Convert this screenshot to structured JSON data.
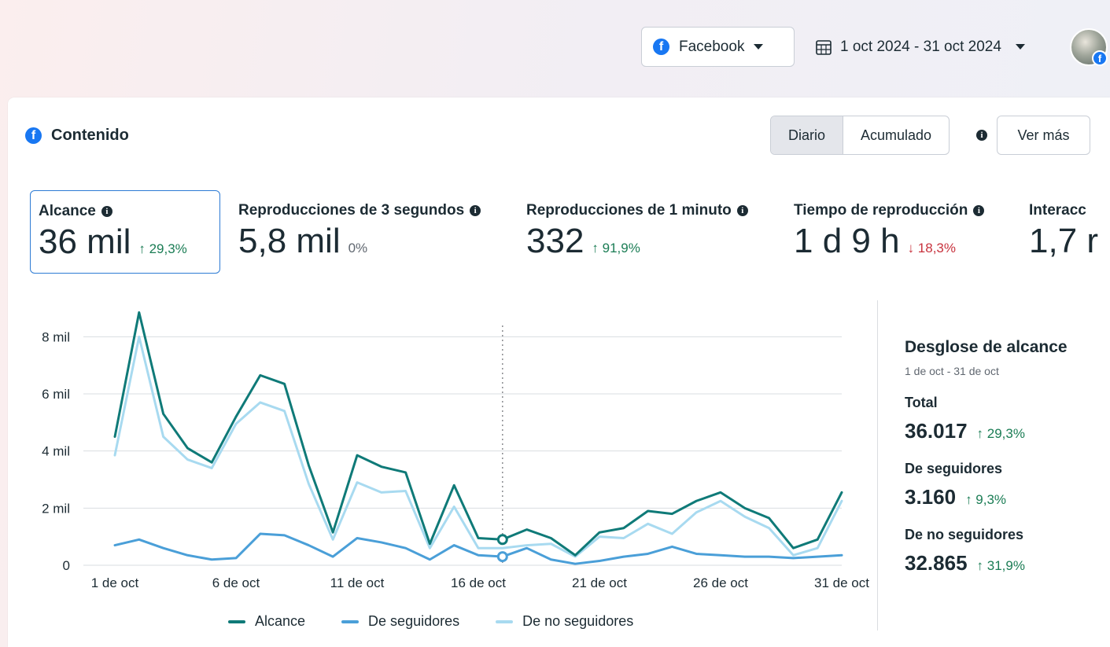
{
  "header": {
    "platform_label": "Facebook",
    "date_range": "1 oct 2024 - 31 oct 2024"
  },
  "card": {
    "title": "Contenido",
    "toggle": {
      "daily": "Diario",
      "cumulative": "Acumulado",
      "active": "daily"
    },
    "see_more": "Ver más"
  },
  "metrics": [
    {
      "label": "Alcance",
      "value": "36 mil",
      "delta": "↑ 29,3%",
      "trend": "up",
      "selected": true
    },
    {
      "label": "Reproducciones de 3 segundos",
      "value": "5,8 mil",
      "delta": "0%",
      "trend": "flat"
    },
    {
      "label": "Reproducciones de 1 minuto",
      "value": "332",
      "delta": "↑ 91,9%",
      "trend": "up"
    },
    {
      "label": "Tiempo de reproducción",
      "value": "1 d 9 h",
      "delta": "↓ 18,3%",
      "trend": "down"
    },
    {
      "label": "Interacc",
      "value": "1,7 r"
    }
  ],
  "breakdown": {
    "title": "Desglose de alcance",
    "subtitle": "1 de oct - 31 de oct",
    "total_label": "Total",
    "total_value": "36.017",
    "total_delta": "↑ 29,3%",
    "followers_label": "De seguidores",
    "followers_value": "3.160",
    "followers_delta": "↑ 9,3%",
    "nonfollowers_label": "De no seguidores",
    "nonfollowers_value": "32.865",
    "nonfollowers_delta": "↑ 31,9%"
  },
  "colors": {
    "alcance": "#0f7a78",
    "seguidores": "#4a9fd8",
    "no_seguidores": "#a8daf0",
    "grid": "#dadde1",
    "hover_line": "#8a8d91"
  },
  "chart_data": {
    "type": "line",
    "x": [
      1,
      2,
      3,
      4,
      5,
      6,
      7,
      8,
      9,
      10,
      11,
      12,
      13,
      14,
      15,
      16,
      17,
      18,
      19,
      20,
      21,
      22,
      23,
      24,
      25,
      26,
      27,
      28,
      29,
      30,
      31
    ],
    "x_ticks": [
      1,
      6,
      11,
      16,
      21,
      26,
      31
    ],
    "x_tick_labels": [
      "1 de oct",
      "6 de oct",
      "11 de oct",
      "16 de oct",
      "21 de oct",
      "26 de oct",
      "31 de oct"
    ],
    "ylim": [
      0,
      9000
    ],
    "y_ticks": [
      0,
      2000,
      4000,
      6000,
      8000
    ],
    "y_tick_labels": [
      "0",
      "2 mil",
      "4 mil",
      "6 mil",
      "8 mil"
    ],
    "grid": true,
    "legend_position": "bottom",
    "hover_x": 17,
    "series": [
      {
        "name": "Alcance",
        "color": "#0f7a78",
        "values": [
          4500,
          8850,
          5300,
          4100,
          3600,
          5200,
          6650,
          6350,
          3500,
          1150,
          3850,
          3450,
          3250,
          750,
          2800,
          950,
          900,
          1250,
          950,
          350,
          1150,
          1300,
          1900,
          1800,
          2250,
          2550,
          2000,
          1650,
          600,
          900,
          2550
        ]
      },
      {
        "name": "De seguidores",
        "color": "#4a9fd8",
        "values": [
          700,
          900,
          600,
          350,
          200,
          250,
          1100,
          1050,
          700,
          300,
          950,
          800,
          600,
          200,
          700,
          350,
          300,
          600,
          200,
          50,
          150,
          300,
          400,
          650,
          400,
          350,
          300,
          300,
          250,
          300,
          350
        ]
      },
      {
        "name": "De no seguidores",
        "color": "#a8daf0",
        "values": [
          3850,
          8000,
          4500,
          3700,
          3400,
          4950,
          5700,
          5400,
          2850,
          900,
          2900,
          2550,
          2600,
          600,
          2050,
          600,
          600,
          700,
          750,
          300,
          1000,
          950,
          1450,
          1100,
          1850,
          2250,
          1700,
          1300,
          350,
          600,
          2250
        ]
      }
    ]
  }
}
